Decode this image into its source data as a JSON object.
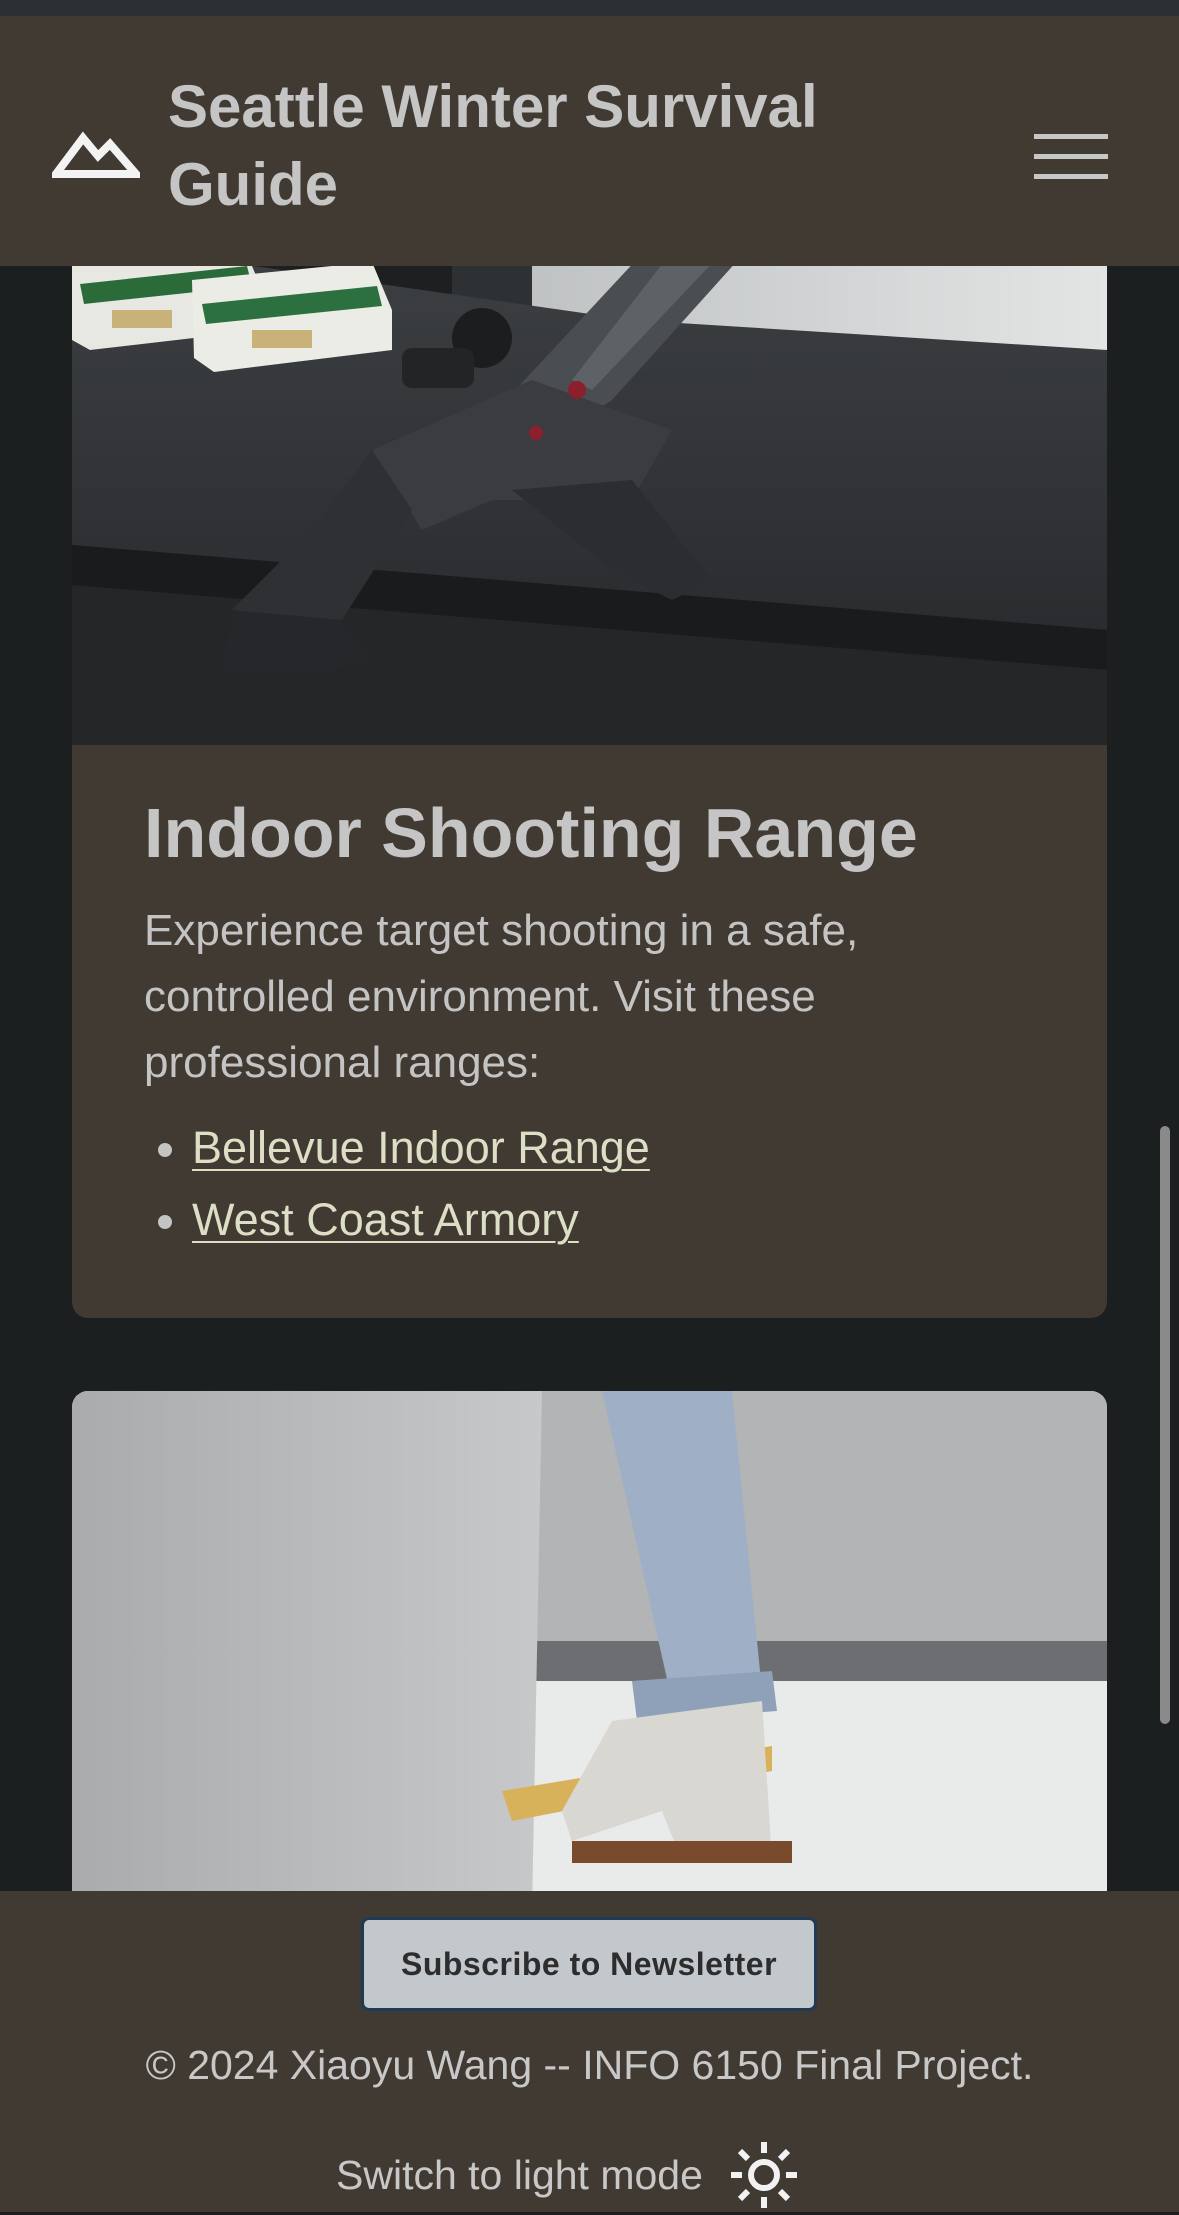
{
  "header": {
    "title": "Seattle Winter Survival Guide",
    "logo_icon": "mountain-icon",
    "menu_icon": "hamburger-menu-icon"
  },
  "range_card": {
    "image": "rifle-on-shooting-bench-photo",
    "title": "Indoor Shooting Range",
    "description": "Experience target shooting in a safe, controlled environment. Visit these professional ranges:",
    "links": [
      {
        "label": "Bellevue Indoor Range"
      },
      {
        "label": "West Coast Armory"
      }
    ]
  },
  "skating_card": {
    "image": "ice-skater-legs-photo"
  },
  "footer": {
    "subscribe_label": "Subscribe to Newsletter",
    "copyright": "© 2024 Xiaoyu Wang -- INFO 6150 Final Project.",
    "mode_toggle_label": "Switch to light mode",
    "mode_toggle_icon": "sun-icon"
  },
  "colors": {
    "page_background": "#1b1f20",
    "surface": "#403a32",
    "link": "#dcdfc6",
    "button_background": "#c3c8cc",
    "button_border": "#1f3a54"
  }
}
